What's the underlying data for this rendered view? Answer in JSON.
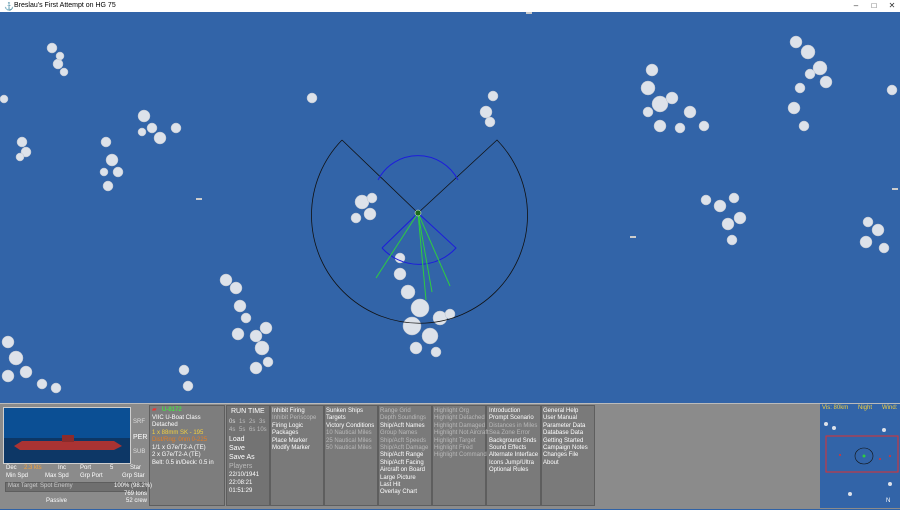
{
  "window": {
    "title": "Breslau's First Attempt on HG 75",
    "minimize_icon": "minimize-icon",
    "maximize_icon": "maximize-icon",
    "close_icon": "close-icon"
  },
  "map": {
    "sea_color": "#3264a8",
    "cloud_color": "#d8dde6",
    "arc_color": "#111111",
    "vision_arc_color": "#1d1ddb",
    "torpedo_line_color": "#2ecc40",
    "unit_marker": "U"
  },
  "unit_info": {
    "flag": "red-flag-icon",
    "name": "U-8172",
    "class": "VIIC U-Boat Class",
    "status": "Detached",
    "line1": "1 x 88mm SK - 195",
    "line2": "Dist/Rng: 0nm 0-225",
    "line3": "1/1 x G7e/T2-A (TE)",
    "line4": "2 x G7e/T2-A (TE)",
    "line5": "Belt: 0.5 in/Deck: 0.5 in",
    "depth_buttons": [
      "SRF",
      "PER",
      "SUB"
    ],
    "row1": {
      "dec": "Dec",
      "speed_val": "2.3 kts",
      "inc": "Inc",
      "port": "Port",
      "five": "5",
      "star": "Star"
    },
    "row2": {
      "min": "Min Spd",
      "max": "Max Spd",
      "grp_port": "Grp Port",
      "grp_star": "Grp Star"
    },
    "row3": {
      "max_target": "Max Target",
      "spot": "Spot Enemy",
      "percent": "100% (98.2%)"
    },
    "tons": "769 tons",
    "passive": "Passive",
    "crew": "52 crew"
  },
  "clock": {
    "run_time": "RUN TIME",
    "speeds": [
      "0s",
      "1s",
      "2s",
      "3s",
      "4s",
      "5s",
      "6s",
      "10s"
    ],
    "load": "Load",
    "save": "Save",
    "save_as": "Save As",
    "players": "Players",
    "date": "22/10/1941",
    "time": "22:08:21",
    "elapsed": "01:51:29"
  },
  "menu_col1": [
    "Inhibit Firing",
    "Inhibit Periscope",
    "Firing Logic",
    "Packages",
    "Place Marker",
    "Modify Marker"
  ],
  "menu_col2": [
    "Sunken Ships",
    "Targets",
    "Victory Conditions",
    "10 Nautical Miles",
    "25 Nautical Miles",
    "50 Nautical Miles"
  ],
  "menu_col3": [
    "Range Grid",
    "Depth Soundings",
    "Ship/Acft Names",
    "Group Names",
    "Ship/Acft Speeds",
    "Ship/Acft Damage",
    "Ship/Acft Range",
    "Ship/Acft Facing",
    "Aircraft on Board",
    "Large Picture",
    "Last Hit",
    "Overlay Chart"
  ],
  "menu_col4": [
    "Highlight Org",
    "Highlight Detached",
    "Highlight Damaged",
    "Highlight Not Aircraft",
    "Highlight Target",
    "Highlight Fired",
    "Highlight Command"
  ],
  "menu_col5": [
    "Introduction",
    "Prompt Scenario",
    "Distances in Miles",
    "Sea Zone Error",
    "Background Snds",
    "Sound Effects",
    "Alternate Interface",
    "Icons Jump/Ultra",
    "Optional Rules"
  ],
  "menu_col6": [
    "General Help",
    "User Manual",
    "Parameter Data",
    "Database Data",
    "Getting Started",
    "Campaign Notes",
    "Changes File",
    "About"
  ],
  "minimap": {
    "vis": "Vis: 80km",
    "night": "Night",
    "wind": "Wind:",
    "north_label": "N"
  }
}
